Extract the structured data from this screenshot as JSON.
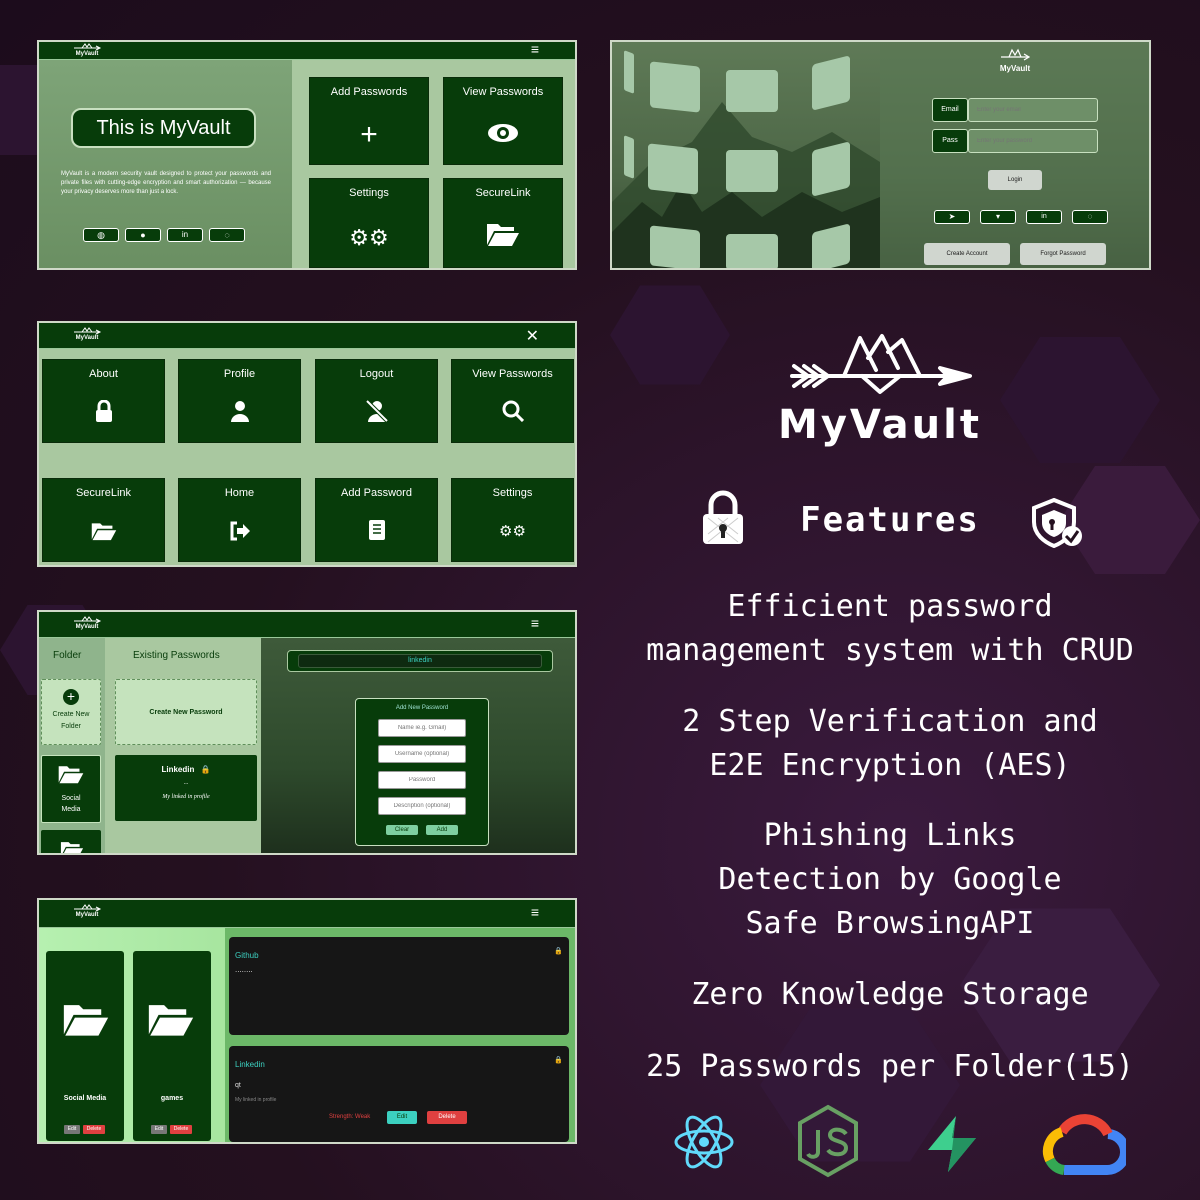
{
  "colors": {
    "bg": "#24101f",
    "dark_green": "#073c0a",
    "light_green": "#a9c8a0",
    "accent": "#3cd0c0"
  },
  "brand": {
    "name": "MyVault"
  },
  "panel1": {
    "hero_title": "This is MyVault",
    "description": "MyVault is a modern security vault designed to protect your passwords and private files with cutting-edge encryption and smart authorization — because your privacy deserves more than just a lock.",
    "social_icons": [
      "globe-icon",
      "github-icon",
      "linkedin-icon",
      "whatsapp-icon"
    ],
    "tiles": [
      "Add Passwords",
      "View Passwords",
      "Settings",
      "SecureLink"
    ]
  },
  "panel2": {
    "email_label": "Email",
    "email_placeholder": "Enter your email",
    "pass_label": "Pass",
    "pass_placeholder": "Enter your password",
    "login": "Login",
    "create_account": "Create Account",
    "forgot_password": "Forgot Password",
    "social_icons": [
      "telegram-icon",
      "twitter-icon",
      "linkedin-icon",
      "whatsapp-icon"
    ]
  },
  "panel3": {
    "tiles": [
      "About",
      "Profile",
      "Logout",
      "View Passwords",
      "SecureLink",
      "Home",
      "Add Password",
      "Settings"
    ]
  },
  "panel4": {
    "folder_header": "Folder",
    "existing_header": "Existing Passwords",
    "create_folder": "Create New Folder",
    "folder1": "Social Media",
    "create_password": "Create New Password",
    "entry_title": "Linkedin",
    "entry_mask": "..",
    "entry_desc": "My linked in profile",
    "search_value": "linkedin",
    "form_title": "Add New Password",
    "ph_name": "Name ie.g. Gmail)",
    "ph_user": "Username (optional)",
    "ph_pass": "Password",
    "ph_desc": "Description (optional)",
    "clear": "Clear",
    "add": "Add"
  },
  "panel5": {
    "folders": [
      {
        "name": "Social Media"
      },
      {
        "name": "games"
      }
    ],
    "edit": "Edit",
    "delete": "Delete",
    "card1": {
      "title": "Github",
      "mask": "........"
    },
    "card2": {
      "title": "Linkedin",
      "user": "qt",
      "desc": "My linked in profile",
      "strength": "Strength: Weak",
      "edit": "Edit",
      "delete": "Delete"
    }
  },
  "right": {
    "logo_text": "MyVault",
    "features_title": "Features",
    "features": [
      [
        "Efficient password",
        "management system with CRUD"
      ],
      [
        "2 Step Verification and",
        "E2E Encryption (AES)"
      ],
      [
        "Phishing Links",
        "Detection by Google",
        "Safe BrowsingAPI"
      ],
      [
        "Zero Knowledge Storage"
      ],
      [
        "25 Passwords per Folder(15)"
      ]
    ],
    "tech_icons": [
      "react-icon",
      "nodejs-icon",
      "supabase-icon",
      "google-cloud-icon"
    ]
  }
}
